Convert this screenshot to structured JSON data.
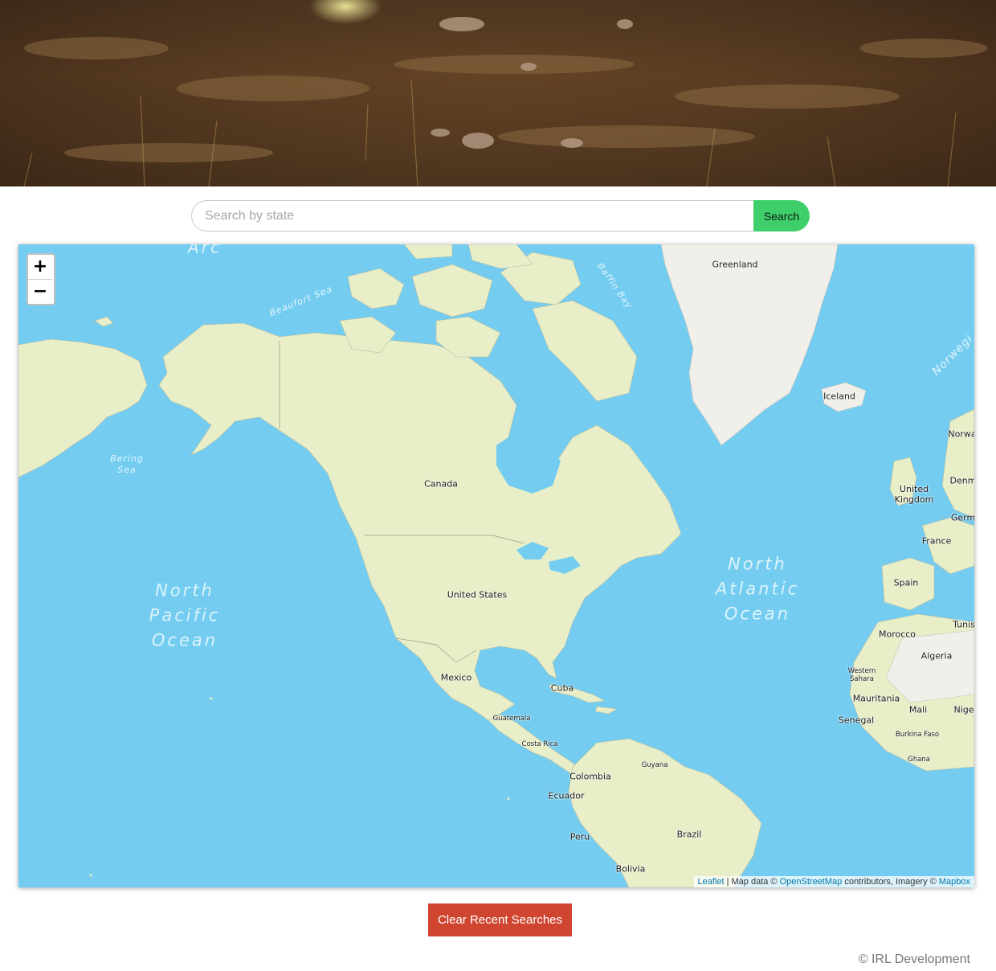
{
  "search": {
    "placeholder": "Search by state",
    "value": "",
    "button_label": "Search"
  },
  "map": {
    "zoom_in_label": "+",
    "zoom_out_label": "−",
    "attribution": {
      "leaflet": "Leaflet",
      "sep1": " | Map data © ",
      "osm": "OpenStreetMap",
      "mid": " contributors, Imagery © ",
      "mapbox": "Mapbox"
    },
    "labels": {
      "greenland": "Greenland",
      "iceland": "Iceland",
      "canada": "Canada",
      "united_states": "United States",
      "mexico": "Mexico",
      "cuba": "Cuba",
      "guatemala": "Guatemala",
      "costa_rica": "Costa Rica",
      "colombia": "Colombia",
      "guyana": "Guyana",
      "ecuador": "Ecuador",
      "peru": "Peru",
      "brazil": "Brazil",
      "bolivia": "Bolivia",
      "norway": "Norwa",
      "denmark": "Denm",
      "united_kingdom": "United\nKingdom",
      "germany": "Germ",
      "france": "France",
      "spain": "Spain",
      "tunisia": "Tunis",
      "morocco": "Morocco",
      "algeria": "Algeria",
      "western_sahara": "Western\nSahara",
      "mauritania": "Mauritania",
      "mali": "Mali",
      "niger": "Nige",
      "senegal": "Senegal",
      "burkina_faso": "Burkina Faso",
      "ghana": "Ghana"
    },
    "water": {
      "north_pacific": "North\nPacific\nOcean",
      "north_atlantic": "North\nAtlantic\nOcean",
      "bering_sea": "Bering\nSea",
      "beaufort_sea": "Beaufort Sea",
      "baffin_bay": "Baffin Bay",
      "arctic": "Arc",
      "norwegian": "Norwegi"
    }
  },
  "clear_button_label": "Clear Recent Searches",
  "footer": "© IRL Development",
  "colors": {
    "search_button": "#3ecf6a",
    "clear_button": "#cf4530",
    "water": "#74cdf0",
    "land": "#e8eec7"
  }
}
